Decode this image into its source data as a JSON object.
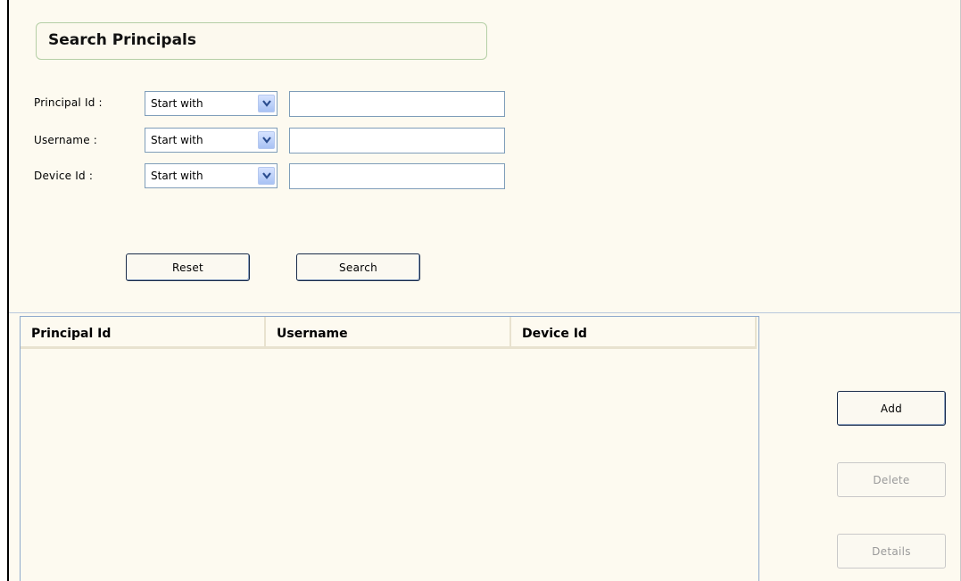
{
  "page": {
    "title": "Search Principals"
  },
  "filters": [
    {
      "label": "Principal Id :",
      "operator": "Start with",
      "value": ""
    },
    {
      "label": "Username :",
      "operator": "Start with",
      "value": ""
    },
    {
      "label": "Device Id :",
      "operator": "Start with",
      "value": ""
    }
  ],
  "actions": {
    "reset_label": "Reset",
    "search_label": "Search"
  },
  "table": {
    "columns": [
      "Principal Id",
      "Username",
      "Device Id"
    ],
    "rows": []
  },
  "side_actions": {
    "add_label": "Add",
    "delete_label": "Delete",
    "details_label": "Details",
    "delete_enabled": false,
    "details_enabled": false
  },
  "icons": {
    "dropdown": "chevron-down-icon"
  },
  "colors": {
    "background": "#fdfaf0",
    "input_border": "#7f9db9",
    "dropdown_button": "#a8c2f4",
    "disabled_text": "#9a9a9a"
  }
}
